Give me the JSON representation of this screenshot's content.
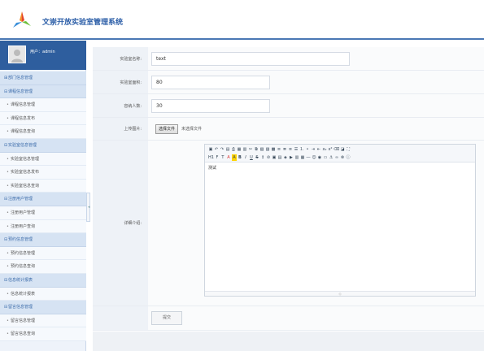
{
  "app": {
    "title": "文崇开放实验室管理系统"
  },
  "user": {
    "label": "用户：admin"
  },
  "sidebar": {
    "sections": [
      {
        "label": "部门信息管理",
        "expanded": false,
        "items": []
      },
      {
        "label": "课程信息管理",
        "expanded": true,
        "items": [
          "课程信息管理",
          "课程信息发布",
          "课程信息查询"
        ]
      },
      {
        "label": "实验室信息管理",
        "expanded": true,
        "items": [
          "实验室信息管理",
          "实验室信息发布",
          "实验室信息查询"
        ]
      },
      {
        "label": "注册用户管理",
        "expanded": true,
        "items": [
          "注册用户管理",
          "注册用户查询"
        ]
      },
      {
        "label": "预约信息管理",
        "expanded": true,
        "items": [
          "预约信息管理",
          "预约信息查询"
        ]
      },
      {
        "label": "信息统计报表",
        "expanded": true,
        "items": [
          "信息统计报表"
        ]
      },
      {
        "label": "留言信息管理",
        "expanded": true,
        "items": [
          "留言信息管理",
          "留言信息查询"
        ]
      }
    ]
  },
  "form": {
    "lab_name": {
      "label": "实验室名称:",
      "value": "text"
    },
    "lab_area": {
      "label": "实验室面积:",
      "value": "80"
    },
    "capacity": {
      "label": "容纳人数:",
      "value": "30"
    },
    "upload": {
      "label": "上传图片:",
      "button": "选择文件",
      "hint": "未选择文件"
    },
    "detail": {
      "label": "详细介绍:",
      "content": "测试"
    },
    "submit": {
      "label": "提交"
    }
  },
  "colors": {
    "accent": "#2e5e9e",
    "header_line": "#4a78b4",
    "menu_section": "#d6e3f3"
  }
}
